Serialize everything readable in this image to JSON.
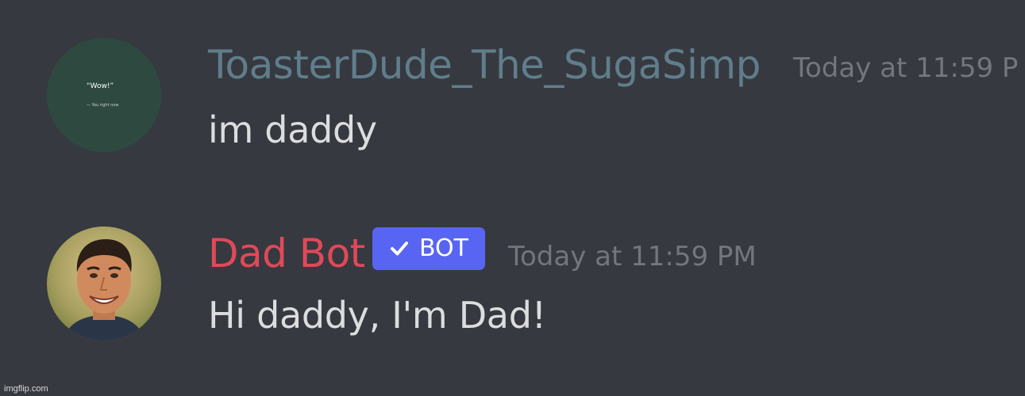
{
  "colors": {
    "background": "#36393f",
    "username_user": "#607d8b",
    "username_bot": "#e04958",
    "bot_tag": "#5865f2",
    "timestamp": "#72767d",
    "message_text": "#dcddde"
  },
  "messages": [
    {
      "username": "ToasterDude_The_SugaSimp",
      "timestamp": "Today at 11:59 P",
      "content": "im daddy",
      "avatar": {
        "icon": "quote-avatar",
        "quote": "“Wow!”",
        "attribution": "— You right now"
      }
    },
    {
      "username": "Dad Bot",
      "bot_tag": {
        "icon": "check-icon",
        "label": "BOT"
      },
      "timestamp": "Today at 11:59 PM",
      "content": "Hi daddy, I'm Dad!",
      "avatar": {
        "icon": "man-smiling-avatar"
      }
    }
  ],
  "watermark": "imgflip.com"
}
